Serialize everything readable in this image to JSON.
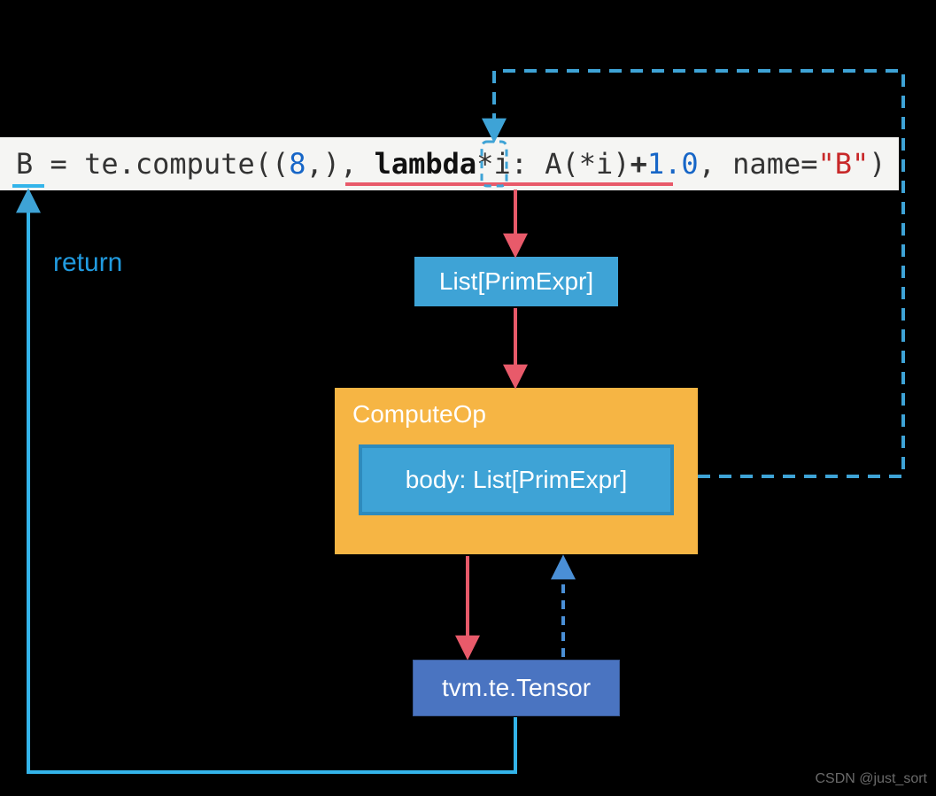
{
  "code": {
    "lhs": "B",
    "assign": " = ",
    "call": "te.compute((",
    "shape_num": "8",
    "after_shape": ",), ",
    "lambda_kw": "lambda",
    "lambda_args": "*i: ",
    "A_call_open": "A",
    "A_args": "(*i)",
    "plus": "+",
    "float_lit": "1.0",
    "after_float": ", name=",
    "name_str": "\"B\"",
    "close": ")"
  },
  "boxes": {
    "primexpr": "List[PrimExpr]",
    "computeop_title": "ComputeOp",
    "body": "body: List[PrimExpr]",
    "tensor": "tvm.te.Tensor"
  },
  "labels": {
    "return": "return"
  },
  "watermark": "CSDN @just_sort",
  "colors": {
    "blue_box": "#3ea3d6",
    "orange_box": "#f6b544",
    "deep_blue_box": "#4a74c1",
    "arrow_red": "#e85a6a",
    "arrow_blue_dash": "#3ea3d6",
    "return_line": "#33b4ea"
  }
}
